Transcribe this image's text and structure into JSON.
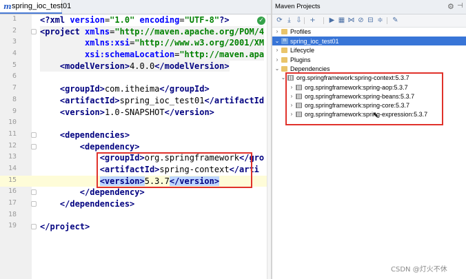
{
  "editor": {
    "tab_label": "spring_ioc_test01",
    "tab_icon_glyph": "m",
    "lines": [
      {
        "num": "1",
        "segments": [
          {
            "t": "<?",
            "c": "pi"
          },
          {
            "t": "xml ",
            "c": "pi"
          },
          {
            "t": "version",
            "c": "attr"
          },
          {
            "t": "=",
            "c": "txt"
          },
          {
            "t": "\"1.0\"",
            "c": "str"
          },
          {
            "t": " encoding",
            "c": "attr"
          },
          {
            "t": "=",
            "c": "txt"
          },
          {
            "t": "\"UTF-8\"",
            "c": "str"
          },
          {
            "t": "?>",
            "c": "pi"
          }
        ]
      },
      {
        "num": "2",
        "segments": [
          {
            "t": "<project ",
            "c": "tag"
          },
          {
            "t": "xmlns",
            "c": "attr"
          },
          {
            "t": "=",
            "c": "txt"
          },
          {
            "t": "\"http://maven.apache.org/POM/4",
            "c": "str"
          }
        ]
      },
      {
        "num": "3",
        "segments": [
          {
            "t": "         ",
            "c": "txt"
          },
          {
            "t": "xmlns:xsi",
            "c": "attr"
          },
          {
            "t": "=",
            "c": "txt"
          },
          {
            "t": "\"http://www.w3.org/2001/XM",
            "c": "str"
          }
        ]
      },
      {
        "num": "4",
        "segments": [
          {
            "t": "         ",
            "c": "txt"
          },
          {
            "t": "xsi:schemaLocation",
            "c": "attr"
          },
          {
            "t": "=",
            "c": "txt"
          },
          {
            "t": "\"http://maven.apa",
            "c": "str"
          }
        ]
      },
      {
        "num": "5",
        "segments": [
          {
            "t": "    ",
            "c": "txt"
          },
          {
            "t": "<modelVersion>",
            "c": "tag"
          },
          {
            "t": "4.0.0",
            "c": "txt"
          },
          {
            "t": "</modelVersion>",
            "c": "tag"
          }
        ]
      },
      {
        "num": "6",
        "segments": []
      },
      {
        "num": "7",
        "segments": [
          {
            "t": "    ",
            "c": "txt"
          },
          {
            "t": "<groupId>",
            "c": "tag"
          },
          {
            "t": "com.itheima",
            "c": "txt"
          },
          {
            "t": "</groupId>",
            "c": "tag"
          }
        ]
      },
      {
        "num": "8",
        "segments": [
          {
            "t": "    ",
            "c": "txt"
          },
          {
            "t": "<artifactId>",
            "c": "tag"
          },
          {
            "t": "spring_ioc_test01",
            "c": "txt"
          },
          {
            "t": "</artifactId",
            "c": "tag"
          }
        ]
      },
      {
        "num": "9",
        "segments": [
          {
            "t": "    ",
            "c": "txt"
          },
          {
            "t": "<version>",
            "c": "tag"
          },
          {
            "t": "1.0-SNAPSHOT",
            "c": "txt"
          },
          {
            "t": "</version>",
            "c": "tag"
          }
        ]
      },
      {
        "num": "10",
        "segments": []
      },
      {
        "num": "11",
        "segments": [
          {
            "t": "    ",
            "c": "txt"
          },
          {
            "t": "<dependencies>",
            "c": "tag"
          }
        ]
      },
      {
        "num": "12",
        "segments": [
          {
            "t": "        ",
            "c": "txt"
          },
          {
            "t": "<dependency>",
            "c": "tag"
          }
        ]
      },
      {
        "num": "13",
        "segments": [
          {
            "t": "            ",
            "c": "txt"
          },
          {
            "t": "<groupId>",
            "c": "tag"
          },
          {
            "t": "org.springframework",
            "c": "txt"
          },
          {
            "t": "</gro",
            "c": "tag"
          }
        ]
      },
      {
        "num": "14",
        "segments": [
          {
            "t": "            ",
            "c": "txt"
          },
          {
            "t": "<artifactId>",
            "c": "tag"
          },
          {
            "t": "spring-context",
            "c": "txt"
          },
          {
            "t": "</arti",
            "c": "tag"
          }
        ]
      },
      {
        "num": "15",
        "segments": [
          {
            "t": "            ",
            "c": "txt"
          },
          {
            "t": "<version>",
            "c": "tag sel"
          },
          {
            "t": "5.3.7",
            "c": "txt"
          },
          {
            "t": "</version>",
            "c": "tag sel"
          }
        ]
      },
      {
        "num": "16",
        "segments": [
          {
            "t": "        ",
            "c": "txt"
          },
          {
            "t": "</dependency>",
            "c": "tag"
          }
        ]
      },
      {
        "num": "17",
        "segments": [
          {
            "t": "    ",
            "c": "txt"
          },
          {
            "t": "</dependencies>",
            "c": "tag"
          }
        ]
      },
      {
        "num": "18",
        "segments": []
      },
      {
        "num": "19",
        "segments": [
          {
            "t": "</project>",
            "c": "tag"
          }
        ]
      }
    ]
  },
  "maven": {
    "title": "Maven Projects",
    "tree": [
      {
        "label": "Profiles",
        "arrow": "›",
        "icon": "folder",
        "depth": 0
      },
      {
        "label": "spring_ioc_test01",
        "arrow": "⌄",
        "icon": "mvn",
        "depth": 0,
        "selected": true
      },
      {
        "label": "Lifecycle",
        "arrow": "›",
        "icon": "folder",
        "depth": 1
      },
      {
        "label": "Plugins",
        "arrow": "›",
        "icon": "folder",
        "depth": 1
      },
      {
        "label": "Dependencies",
        "arrow": "⌄",
        "icon": "folder",
        "depth": 1
      },
      {
        "label": "org.springframework:spring-context:5.3.7",
        "arrow": "⌄",
        "icon": "lib",
        "depth": 2
      },
      {
        "label": "org.springframework:spring-aop:5.3.7",
        "arrow": "›",
        "icon": "lib",
        "depth": 3
      },
      {
        "label": "org.springframework:spring-beans:5.3.7",
        "arrow": "›",
        "icon": "lib",
        "depth": 3
      },
      {
        "label": "org.springframework:spring-core:5.3.7",
        "arrow": "›",
        "icon": "lib",
        "depth": 3
      },
      {
        "label": "org.springframework:spring-expression:5.3.7",
        "arrow": "›",
        "icon": "lib",
        "depth": 3
      }
    ],
    "toolbar_icons": [
      "refresh-icon",
      "add-sources-icon",
      "download-icon",
      "add-project-icon",
      "run-icon",
      "lifecycle-icon",
      "toggle-offline-icon",
      "skip-tests-icon",
      "show-dependencies-icon",
      "collapse-all-icon",
      "settings-wrench-icon"
    ]
  },
  "watermark": "CSDN @灯火不休",
  "colors": {
    "highlight_box": "#e0312a",
    "selected_row": "#3875d7",
    "current_line": "#fefcd8"
  }
}
